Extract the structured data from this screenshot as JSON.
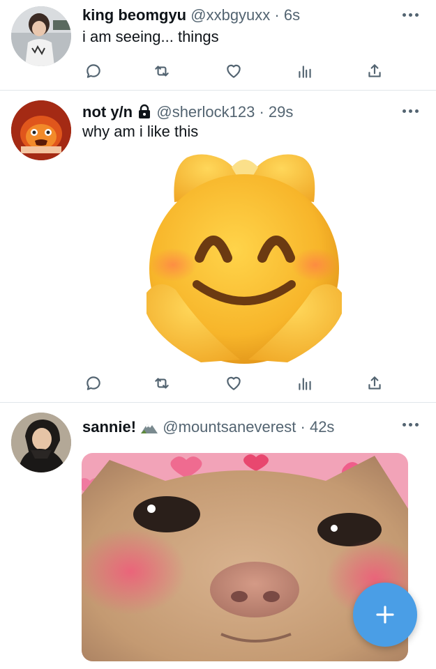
{
  "tweets": [
    {
      "name": "king beomgyu",
      "handle": "@xxbgyuxx",
      "separator": "·",
      "time": "6s",
      "text": "i am seeing... things",
      "avatar_icon": "profile-photo"
    },
    {
      "name": "not y/n",
      "badge_icon": "lock-icon",
      "handle": "@sherlock123",
      "separator": "·",
      "time": "29s",
      "text": "why am i like this",
      "avatar_icon": "calcifer-avatar",
      "media_icon": "smiling-face-emoji"
    },
    {
      "name": "sannie!",
      "badge_icon": "mountain-emoji",
      "handle": "@mountsaneverest",
      "separator": "·",
      "time": "42s",
      "avatar_icon": "profile-photo",
      "media_icon": "blushing-cat-photo"
    }
  ],
  "colors": {
    "accent": "#4a9ee6",
    "secondary_text": "#536471",
    "divider": "#e1e6ea"
  }
}
